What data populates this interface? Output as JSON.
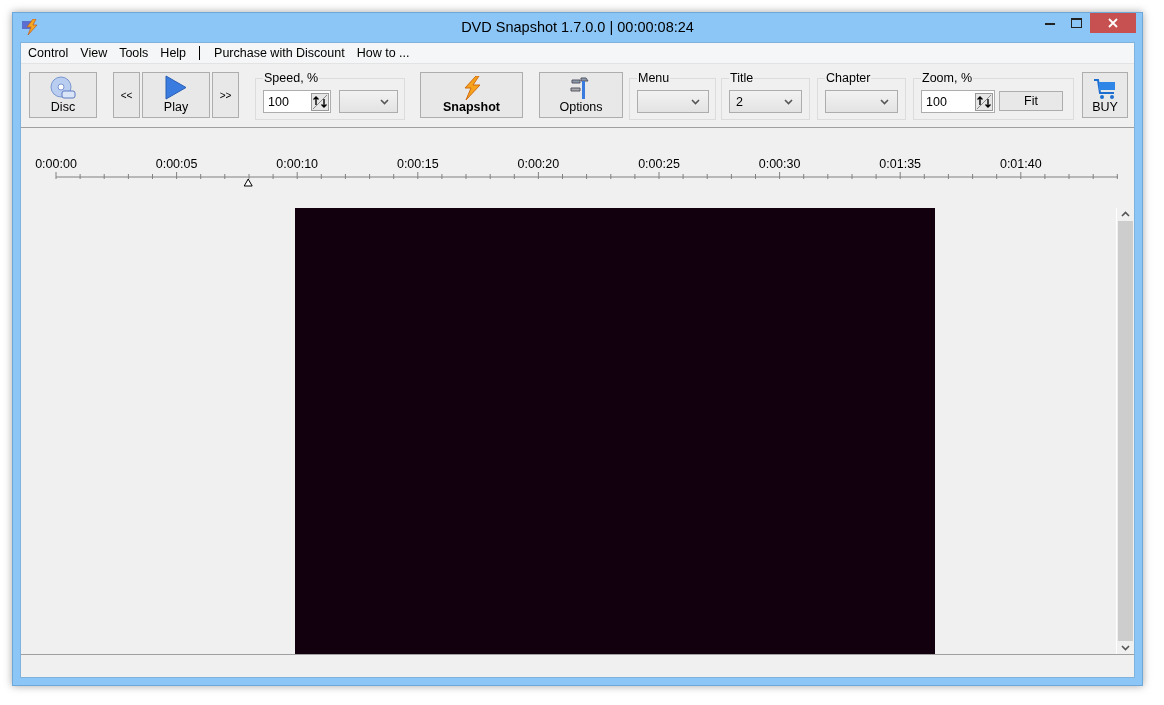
{
  "window": {
    "title": "DVD Snapshot 1.7.0.0 | 00:00:08:24"
  },
  "menu": [
    {
      "kind": "item",
      "label": "Control"
    },
    {
      "kind": "item",
      "label": "View"
    },
    {
      "kind": "item",
      "label": "Tools"
    },
    {
      "kind": "item",
      "label": "Help"
    },
    {
      "kind": "separator"
    },
    {
      "kind": "item",
      "label": "Purchase with Discount"
    },
    {
      "kind": "item",
      "label": "How to ..."
    }
  ],
  "toolbar": {
    "disc_button": "Disc",
    "back_button": "<<",
    "play_button": "Play",
    "forward_button": ">>",
    "speed": {
      "label": "Speed, %",
      "value": "100"
    },
    "snapshot_button": "Snapshot",
    "options_button": "Options",
    "menu_select": {
      "label": "Menu"
    },
    "title_select": {
      "label": "Title",
      "value": "2"
    },
    "chapter_select": {
      "label": "Chapter"
    },
    "zoom": {
      "label": "Zoom, %",
      "value": "100",
      "fit_button": "Fit"
    },
    "buy_button": "BUY"
  },
  "timeline": {
    "labels": [
      "0:00:00",
      "0:00:05",
      "0:00:10",
      "0:00:15",
      "0:00:20",
      "0:00:25",
      "0:00:30",
      "0:01:35",
      "0:01:40"
    ],
    "playhead": {
      "level": 0.181
    }
  }
}
